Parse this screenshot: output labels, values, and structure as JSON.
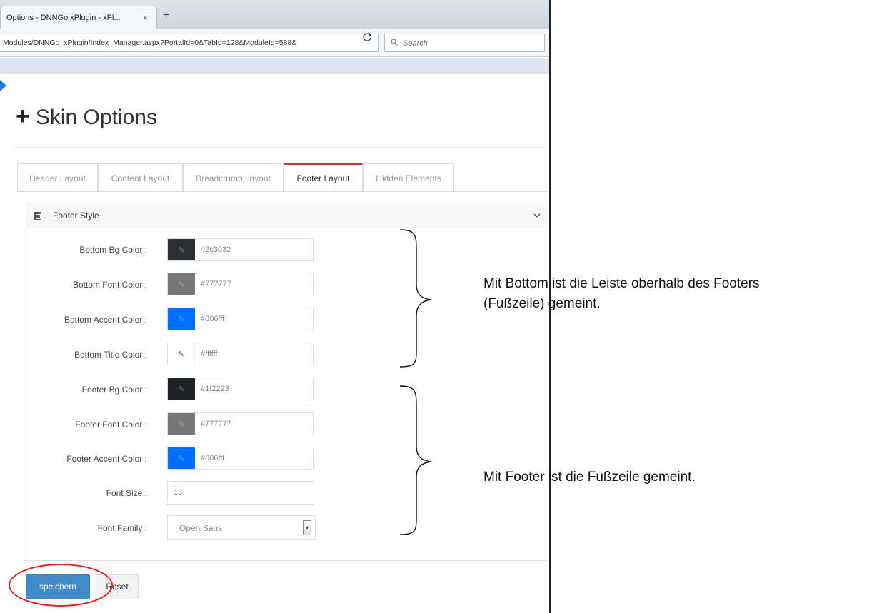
{
  "browser": {
    "tab_title": "Options - DNNGo xPlugin - xPl...",
    "tab_close": "×",
    "new_tab": "+",
    "url": "Modules/DNNGo_xPlugin/Index_Manager.aspx?PortalId=0&TabId=128&ModuleId=588&",
    "reload_icon": "C",
    "search_placeholder": "Search",
    "search_icon": "Q"
  },
  "page": {
    "title": "Skin Options",
    "title_icon": "+"
  },
  "tabs": [
    {
      "label": "Header Layout",
      "active": false
    },
    {
      "label": "Content Layout",
      "active": false
    },
    {
      "label": "Breadcrumb Layout",
      "active": false
    },
    {
      "label": "Footer Layout",
      "active": true
    },
    {
      "label": "Hidden Elements",
      "active": false
    }
  ],
  "panel": {
    "title": "Footer Style",
    "collapse_icon": "chevron-down-icon"
  },
  "fields": [
    {
      "label": "Bottom Bg Color :",
      "type": "color",
      "value": "#2c3032",
      "swatch": "#2c3032"
    },
    {
      "label": "Bottom Font Color :",
      "type": "color",
      "value": "#777777",
      "swatch": "#777777"
    },
    {
      "label": "Bottom Accent Color :",
      "type": "color",
      "value": "#006fff",
      "swatch": "#006fff"
    },
    {
      "label": "Bottom Title Color :",
      "type": "color",
      "value": "#ffffff",
      "swatch": "#ffffff"
    },
    {
      "label": "Footer Bg Color :",
      "type": "color",
      "value": "#1f2223",
      "swatch": "#1f2223"
    },
    {
      "label": "Footer Font Color :",
      "type": "color",
      "value": "#777777",
      "swatch": "#777777"
    },
    {
      "label": "Footer Accent Color :",
      "type": "color",
      "value": "#006fff",
      "swatch": "#006fff"
    },
    {
      "label": "Font Size :",
      "type": "text",
      "value": "13"
    },
    {
      "label": "Font Family :",
      "type": "select",
      "value": "Open Sans"
    }
  ],
  "buttons": {
    "save": "speichern",
    "reset": "Reset"
  },
  "annotations": {
    "bottom_note_line1": "Mit Bottom ist die Leiste oberhalb des Footers",
    "bottom_note_line2": "(Fußzeile) gemeint.",
    "footer_note": "Mit Footer ist die Fußzeile gemeint."
  },
  "colors": {
    "primary_button": "#428bca",
    "highlight_ellipse": "#e02020",
    "active_tab_border": "#c0392b"
  }
}
